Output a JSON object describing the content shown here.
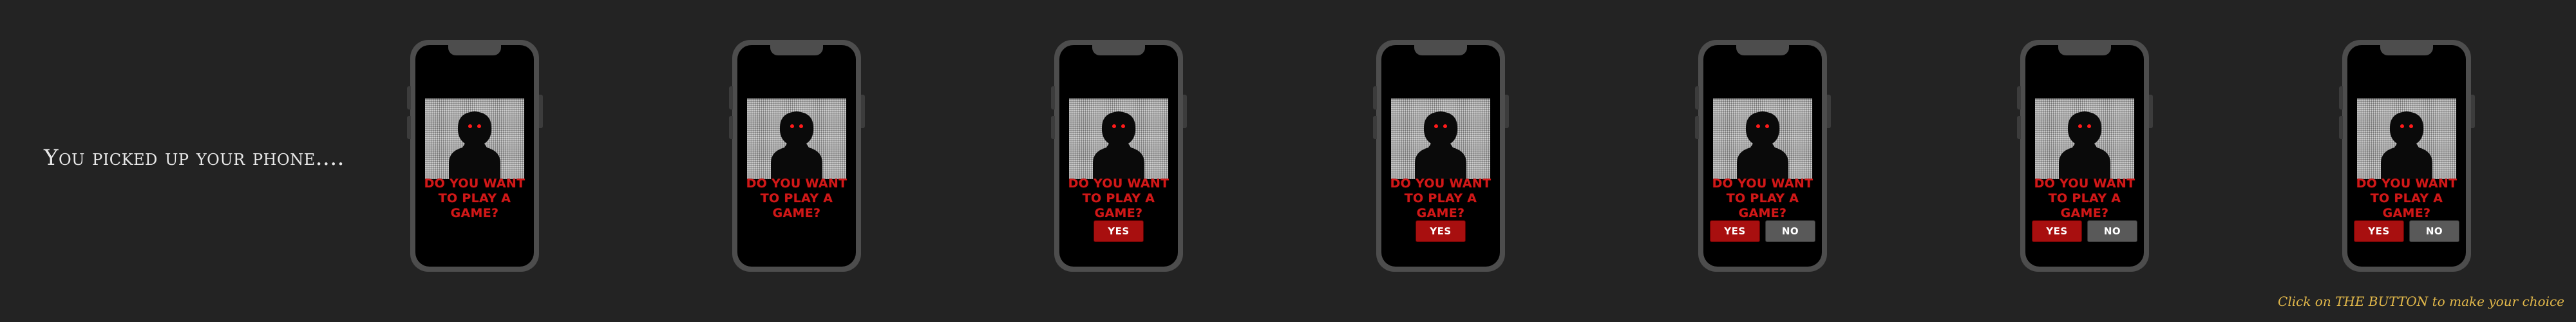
{
  "intro_text": "You picked up your phone....",
  "hint_text": "Click on THE BUTTON to make your choice",
  "phone": {
    "question": "DO YOU WANT TO PLAY A GAME?",
    "yes_label": "YES",
    "no_label": "NO"
  },
  "frames": [
    {
      "yes_visible": false,
      "no_visible": false
    },
    {
      "yes_visible": false,
      "no_visible": false
    },
    {
      "yes_visible": true,
      "no_visible": false
    },
    {
      "yes_visible": true,
      "no_visible": false
    },
    {
      "yes_visible": true,
      "no_visible": true
    },
    {
      "yes_visible": true,
      "no_visible": true
    },
    {
      "yes_visible": true,
      "no_visible": true
    }
  ],
  "colors": {
    "background": "#232323",
    "question_red": "#d01818",
    "yes_button": "#a80f0f",
    "no_button": "#595959",
    "hint_yellow": "#e2b84a",
    "eye_red": "#ff1a1a"
  }
}
